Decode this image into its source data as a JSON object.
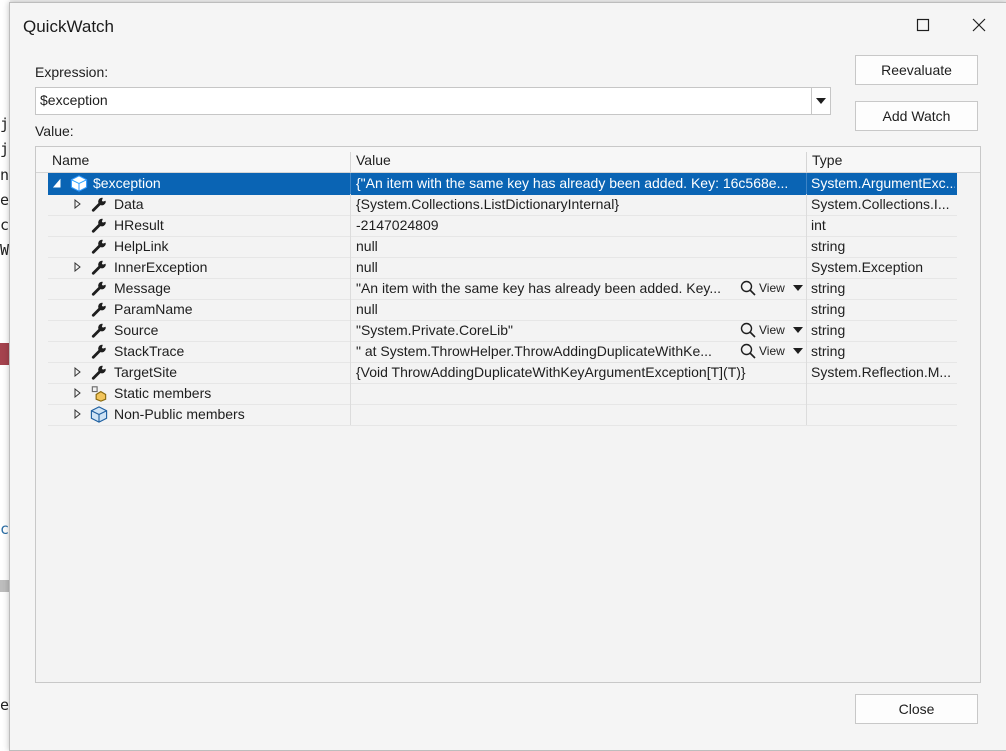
{
  "background_fragments": [
    "ju",
    "ju",
    "na",
    "eN",
    "cI",
    "W",
    "c",
    "e"
  ],
  "dialog": {
    "title": "QuickWatch",
    "expression_label": "Expression:",
    "expression_value": "$exception",
    "value_label": "Value:",
    "reevaluate_label": "Reevaluate",
    "add_watch_label": "Add Watch",
    "close_label": "Close"
  },
  "grid": {
    "columns": {
      "name": "Name",
      "value": "Value",
      "type": "Type"
    },
    "view_label": "View",
    "rows": [
      {
        "name": "$exception",
        "value": "{\"An item with the same key has already been added. Key: 16c568e...",
        "type": "System.ArgumentExc...",
        "icon": "exception-object-icon",
        "expander": "expanded",
        "selected": true
      },
      {
        "name": "Data",
        "value": "{System.Collections.ListDictionaryInternal}",
        "type": "System.Collections.I...",
        "icon": "property-wrench-icon",
        "expander": "collapsed"
      },
      {
        "name": "HResult",
        "value": "-2147024809",
        "type": "int",
        "icon": "property-wrench-icon",
        "expander": "none"
      },
      {
        "name": "HelpLink",
        "value": "null",
        "type": "string",
        "icon": "property-wrench-icon",
        "expander": "none"
      },
      {
        "name": "InnerException",
        "value": "null",
        "type": "System.Exception",
        "icon": "property-wrench-icon",
        "expander": "collapsed"
      },
      {
        "name": "Message",
        "value": "\"An item with the same key has already been added. Key...",
        "type": "string",
        "icon": "property-wrench-icon",
        "expander": "none",
        "view": true
      },
      {
        "name": "ParamName",
        "value": "null",
        "type": "string",
        "icon": "property-wrench-icon",
        "expander": "none"
      },
      {
        "name": "Source",
        "value": "\"System.Private.CoreLib\"",
        "type": "string",
        "icon": "property-wrench-icon",
        "expander": "none",
        "view": true
      },
      {
        "name": "StackTrace",
        "value": "\"   at System.ThrowHelper.ThrowAddingDuplicateWithKe...",
        "type": "string",
        "icon": "property-wrench-icon",
        "expander": "none",
        "view": true
      },
      {
        "name": "TargetSite",
        "value": "{Void ThrowAddingDuplicateWithKeyArgumentException[T](T)}",
        "type": "System.Reflection.M...",
        "icon": "property-wrench-icon",
        "expander": "collapsed"
      },
      {
        "name": "Static members",
        "value": "",
        "type": "",
        "icon": "static-members-icon",
        "expander": "collapsed"
      },
      {
        "name": "Non-Public members",
        "value": "",
        "type": "",
        "icon": "non-public-members-icon",
        "expander": "collapsed"
      }
    ]
  },
  "colors": {
    "selection": "#0a64b4",
    "dialog_bg": "#f5f5f5"
  }
}
